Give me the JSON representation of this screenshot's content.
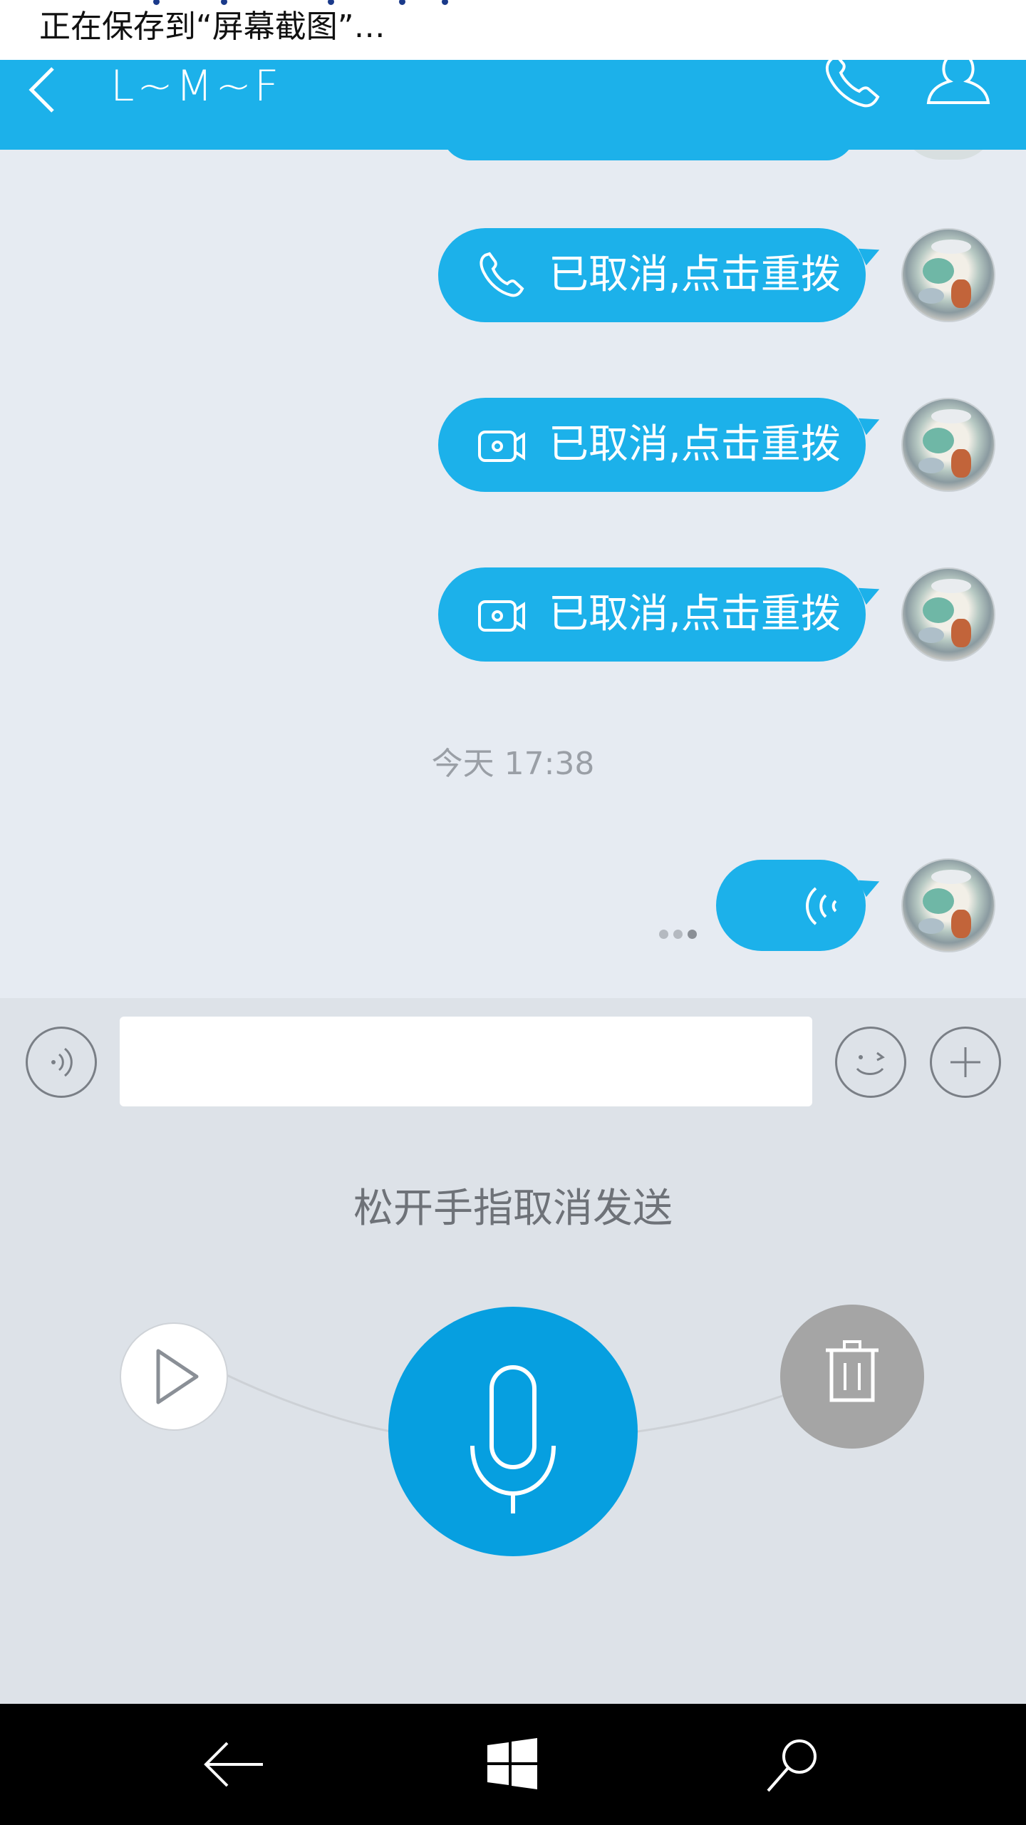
{
  "toast": {
    "text": "正在保存到“屏幕截图”…"
  },
  "header": {
    "title": "L~M~F"
  },
  "messages": [
    {
      "kind": "voice-call",
      "text": "已取消,点击重拨"
    },
    {
      "kind": "video-call",
      "text": "已取消,点击重拨"
    },
    {
      "kind": "video-call",
      "text": "已取消,点击重拨"
    }
  ],
  "time_separator": "今天 17:38",
  "input": {
    "placeholder": ""
  },
  "recorder": {
    "hint": "松开手指取消发送"
  },
  "colors": {
    "accent": "#1cb1ea",
    "mic": "#069fe0",
    "panel": "#dde2e8",
    "chat_bg": "#e6ebf2"
  },
  "icons": {
    "header": [
      "back-icon",
      "phone-icon",
      "profile-icon"
    ],
    "input_bar": [
      "voice-icon",
      "emoji-icon",
      "plus-icon"
    ],
    "recorder": [
      "play-icon",
      "microphone-icon",
      "trash-icon"
    ],
    "navbar": [
      "back-arrow-icon",
      "windows-icon",
      "search-icon"
    ]
  }
}
